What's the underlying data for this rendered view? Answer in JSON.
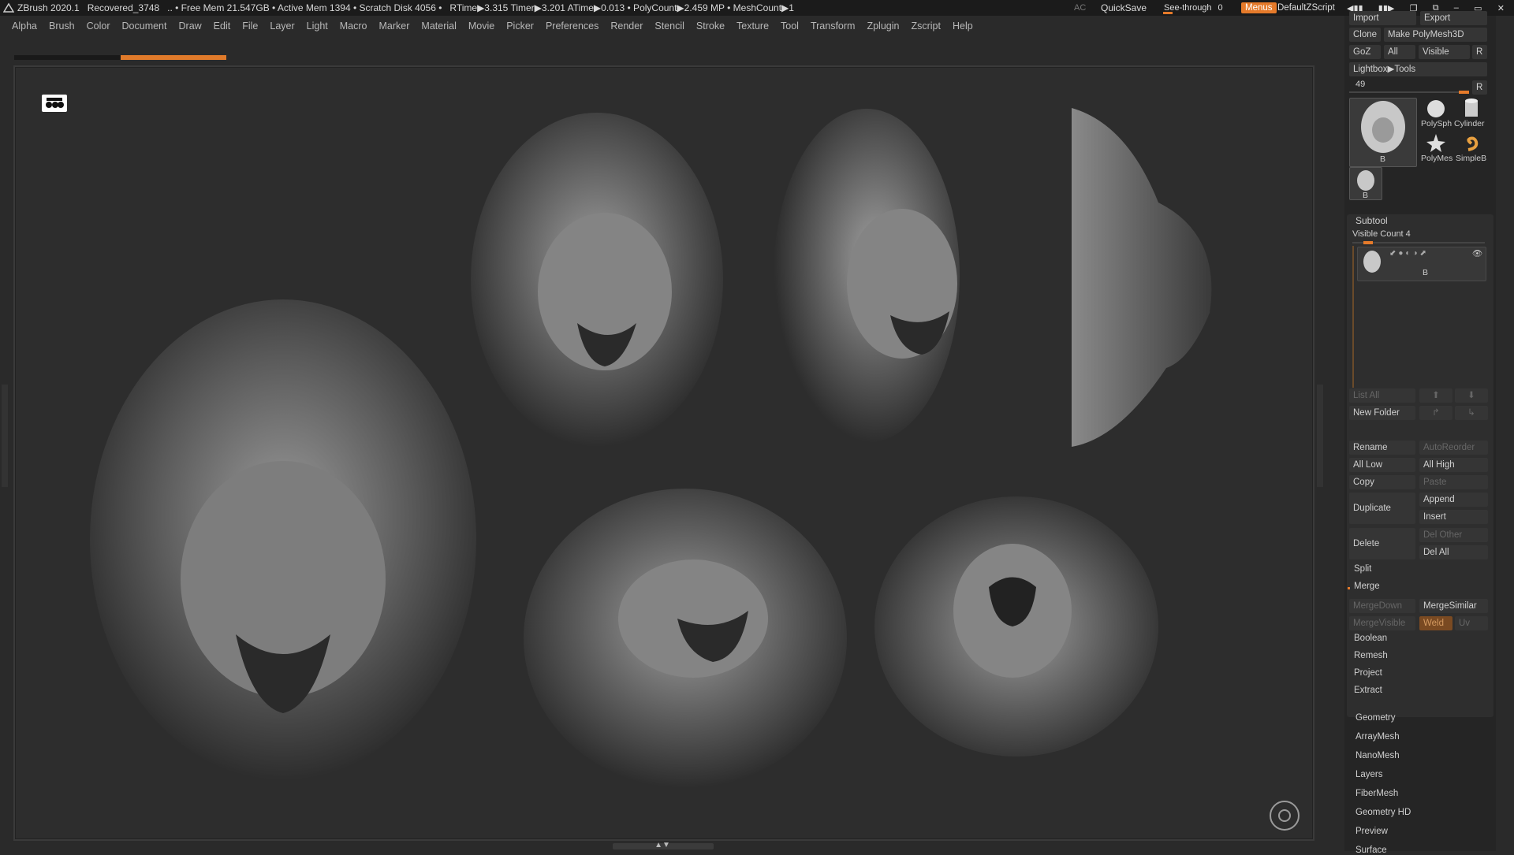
{
  "titlebar": {
    "app": "ZBrush 2020.1",
    "doc": "Recovered_3748",
    "stats": ".. • Free Mem 21.547GB • Active Mem 1394 • Scratch Disk 4056 •",
    "rtime": "RTime▶3.315 Timer▶3.201 ATime▶0.013 • PolyCount▶2.459 MP • MeshCount▶1",
    "ac": "AC",
    "quicksave": "QuickSave",
    "see_through_label": "See-through",
    "see_through_value": "0",
    "menus": "Menus",
    "default_zscript": "DefaultZScript"
  },
  "menubar": [
    "Alpha",
    "Brush",
    "Color",
    "Document",
    "Draw",
    "Edit",
    "File",
    "Layer",
    "Light",
    "Macro",
    "Marker",
    "Material",
    "Movie",
    "Picker",
    "Preferences",
    "Render",
    "Stencil",
    "Stroke",
    "Texture",
    "Tool",
    "Transform",
    "Zplugin",
    "Zscript",
    "Help"
  ],
  "tool_panel": {
    "import": "Import",
    "export": "Export",
    "clone": "Clone",
    "make_polymesh": "Make PolyMesh3D",
    "goz": "GoZ",
    "all": "All",
    "visible": "Visible",
    "r": "R",
    "lightbox_tools": "Lightbox▶Tools",
    "tool_count": "49",
    "r2": "R",
    "polysph": "PolySph",
    "cylinder": "Cylinder",
    "polymesh": "PolyMes",
    "simpleb": "SimpleB",
    "b_main": "B",
    "b_small": "B"
  },
  "subtool": {
    "title": "Subtool",
    "visible_count": "Visible Count 4",
    "item_label": "B",
    "list_all": "List All",
    "new_folder": "New Folder",
    "rename": "Rename",
    "auto_reorder": "AutoReorder",
    "all_low": "All Low",
    "all_high": "All High",
    "copy": "Copy",
    "paste": "Paste",
    "duplicate": "Duplicate",
    "append": "Append",
    "insert": "Insert",
    "delete": "Delete",
    "del_other": "Del Other",
    "del_all": "Del All",
    "split": "Split",
    "merge": "Merge",
    "merge_down": "MergeDown",
    "merge_similar": "MergeSimilar",
    "merge_visible": "MergeVisible",
    "weld": "Weld",
    "uv": "Uv",
    "boolean": "Boolean",
    "remesh": "Remesh",
    "project": "Project",
    "extract": "Extract"
  },
  "tool_sections": [
    "Geometry",
    "ArrayMesh",
    "NanoMesh",
    "Layers",
    "FiberMesh",
    "Geometry HD",
    "Preview",
    "Surface"
  ],
  "colors": {
    "accent": "#e57a2a",
    "canvas": "#2d2d2d",
    "panel": "#252525"
  }
}
